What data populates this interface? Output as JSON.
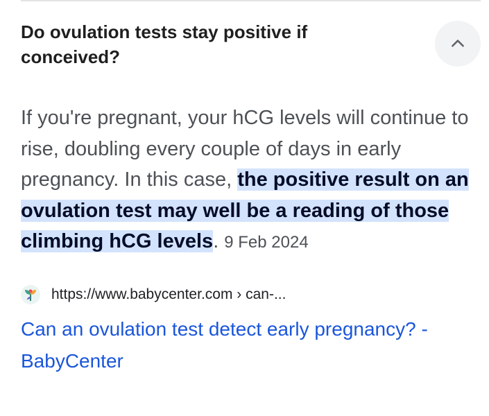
{
  "question": {
    "title": "Do ovulation tests stay positive if conceived?"
  },
  "answer": {
    "text_before": "If you're pregnant, your hCG levels will continue to rise, doubling every couple of days in early pregnancy. In this case, ",
    "highlight": "the positive result on an ovulation test may well be a reading of those climbing hCG levels",
    "text_after": ".",
    "date": "9 Feb 2024"
  },
  "source": {
    "url": "https://www.babycenter.com › can-...",
    "link_title": "Can an ovulation test detect early pregnancy? - BabyCenter",
    "favicon": "babycenter-icon"
  },
  "controls": {
    "collapse_icon": "chevron-up-icon"
  },
  "colors": {
    "highlight_bg": "#d3e3fd",
    "link": "#1a56db",
    "body_text": "#4d5156",
    "title_text": "#1f1f1f"
  }
}
